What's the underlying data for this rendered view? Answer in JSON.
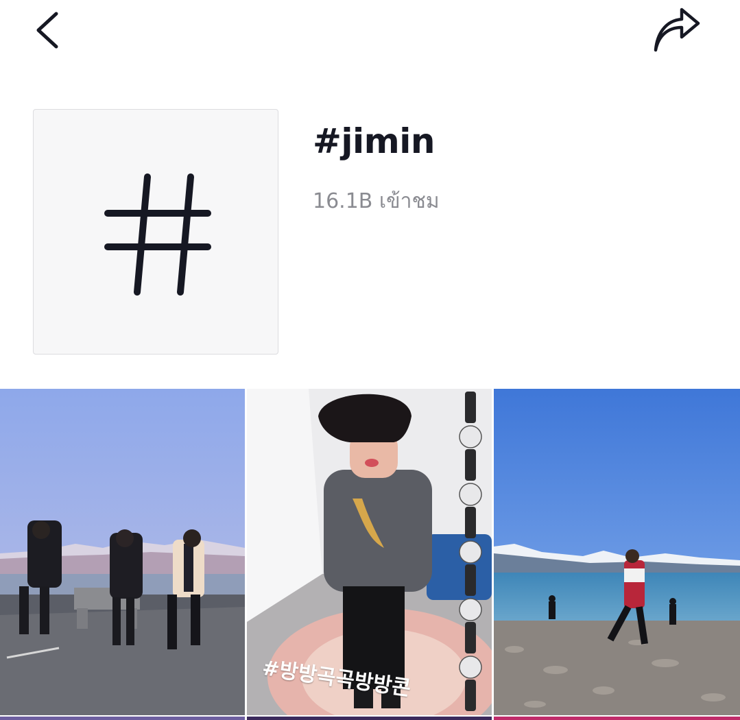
{
  "header": {
    "back_icon": "chevron-left-icon",
    "share_icon": "share-arrow-icon"
  },
  "hashtag": {
    "icon": "hashtag-icon",
    "title": "#jimin",
    "views": "16.1B เข้าชม"
  },
  "videos": [
    {
      "id": "video-1",
      "scene": "three dancers at dusk by a mountain lake",
      "overlay_text": ""
    },
    {
      "id": "video-2",
      "scene": "person in grey banana sweater in a hallway",
      "overlay_text": "#방방곡곡방방콘"
    },
    {
      "id": "video-3",
      "scene": "people on a pebble lakeshore with mountains",
      "overlay_text": ""
    }
  ],
  "colors": {
    "text_primary": "#161823",
    "text_secondary": "#8a8b91",
    "thumb_bg": "#f7f7f8"
  }
}
